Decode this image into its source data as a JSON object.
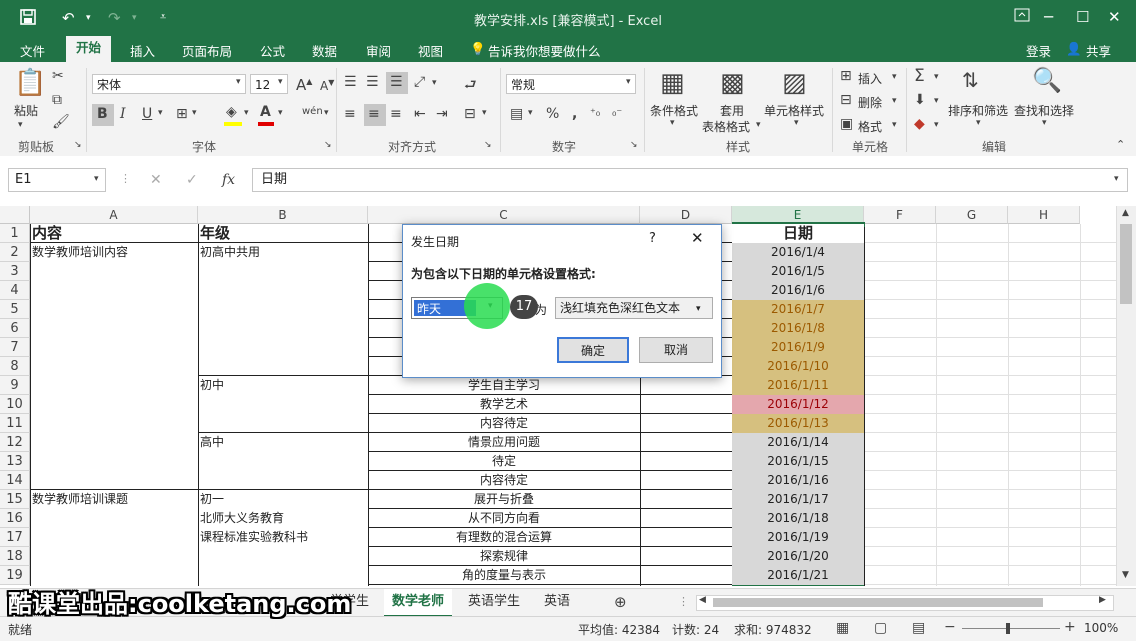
{
  "app": {
    "title": "教学安排.xls [兼容模式] - Excel",
    "login": "登录",
    "share": "共享"
  },
  "menu": {
    "tabs": [
      "文件",
      "开始",
      "插入",
      "页面布局",
      "公式",
      "数据",
      "审阅",
      "视图"
    ],
    "tell_me": "告诉我你想要做什么"
  },
  "ribbon": {
    "paste": "粘贴",
    "font_name": "宋体",
    "font_size": "12",
    "number_format": "常规",
    "cond_format": "条件格式",
    "table_format_1": "套用",
    "table_format_2": "表格格式",
    "cell_style": "单元格样式",
    "insert": "插入",
    "delete": "删除",
    "format": "格式",
    "sort_filter": "排序和筛选",
    "find_select": "查找和选择",
    "groups": [
      "剪贴板",
      "字体",
      "对齐方式",
      "数字",
      "样式",
      "单元格",
      "编辑"
    ]
  },
  "formula": {
    "name_box": "E1",
    "fx": "fx",
    "content": "日期"
  },
  "columns": [
    "A",
    "B",
    "C",
    "D",
    "E",
    "F",
    "G",
    "H"
  ],
  "rows": [
    "1",
    "2",
    "3",
    "4",
    "5",
    "6",
    "7",
    "8",
    "9",
    "10",
    "11",
    "12",
    "13",
    "14",
    "15",
    "16",
    "17",
    "18",
    "19"
  ],
  "cells": {
    "A1": "内容",
    "B1": "年级",
    "E1": "日期",
    "A2": "数学教师培训内容",
    "B2": "初高中共用",
    "B9": "初中",
    "B12": "高中",
    "A15": "数学教师培训课题",
    "B15": "初一",
    "B16": "北师大义务教育",
    "B17": "课程标准实验教科书",
    "C9": "学生自主学习",
    "C10": "教学艺术",
    "C11": "内容待定",
    "C12": "情景应用问题",
    "C13": "待定",
    "C14": "内容待定",
    "C15": "展开与折叠",
    "C16": "从不同方向看",
    "C17": "有理数的混合运算",
    "C18": "探索规律",
    "C19": "角的度量与表示"
  },
  "dates": [
    "2016/1/4",
    "2016/1/5",
    "2016/1/6",
    "2016/1/7",
    "2016/1/8",
    "2016/1/9",
    "2016/1/10",
    "2016/1/11",
    "2016/1/12",
    "2016/1/13",
    "2016/1/14",
    "2016/1/15",
    "2016/1/16",
    "2016/1/17",
    "2016/1/18",
    "2016/1/19",
    "2016/1/20",
    "2016/1/21"
  ],
  "colors": {
    "excel_green": "#217346",
    "highlight_gold": "#d6c07f",
    "highlight_red": "#e4a7ad",
    "date_gray": "#d8d8d8"
  },
  "dialog": {
    "title": "发生日期",
    "help": "?",
    "prompt": "为包含以下日期的单元格设置格式:",
    "period": "昨天",
    "set_as": "设置为",
    "format": "浅红填充色深红色文本",
    "ok": "确定",
    "cancel": "取消",
    "step_badge": "17"
  },
  "sheets": {
    "partial": "学学生",
    "active": "数学老师",
    "tab3": "英语学生",
    "tab4": "英语"
  },
  "status": {
    "ready": "就绪",
    "average": "平均值: 42384",
    "count": "计数: 24",
    "sum": "求和: 974832",
    "zoom": "100%"
  },
  "watermark": "酷课堂出品:coolketang.com"
}
